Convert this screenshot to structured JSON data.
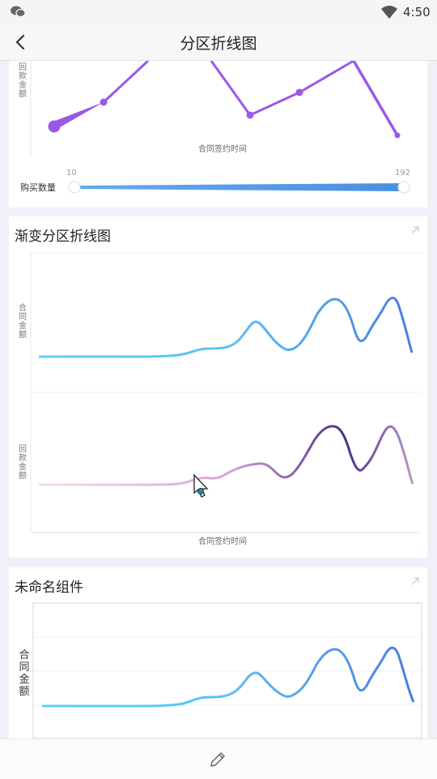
{
  "status_bar": {
    "time": "4:50",
    "icons": [
      "wechat-icon",
      "wifi-icon"
    ]
  },
  "nav": {
    "title": "分区折线图",
    "back_icon": "back-arrow-icon"
  },
  "card1": {
    "y_label": "回款金额",
    "x_label": "合同签约时间",
    "slider": {
      "label": "购买数量",
      "min": "10",
      "max": "192"
    },
    "accent": "#9b59e6"
  },
  "card2": {
    "title": "渐变分区折线图",
    "y_label_top": "合同金额",
    "y_label_bottom": "回款金额",
    "x_label": "合同签约时间",
    "colors": {
      "blue_start": "#5ed0f8",
      "blue_end": "#4a7de0",
      "purple_start": "#f5d7ef",
      "purple_end": "#4b2f8a"
    }
  },
  "card3": {
    "title": "未命名组件",
    "y_label": "合同金额"
  },
  "bottom_bar": {
    "icon": "pencil-icon"
  }
}
